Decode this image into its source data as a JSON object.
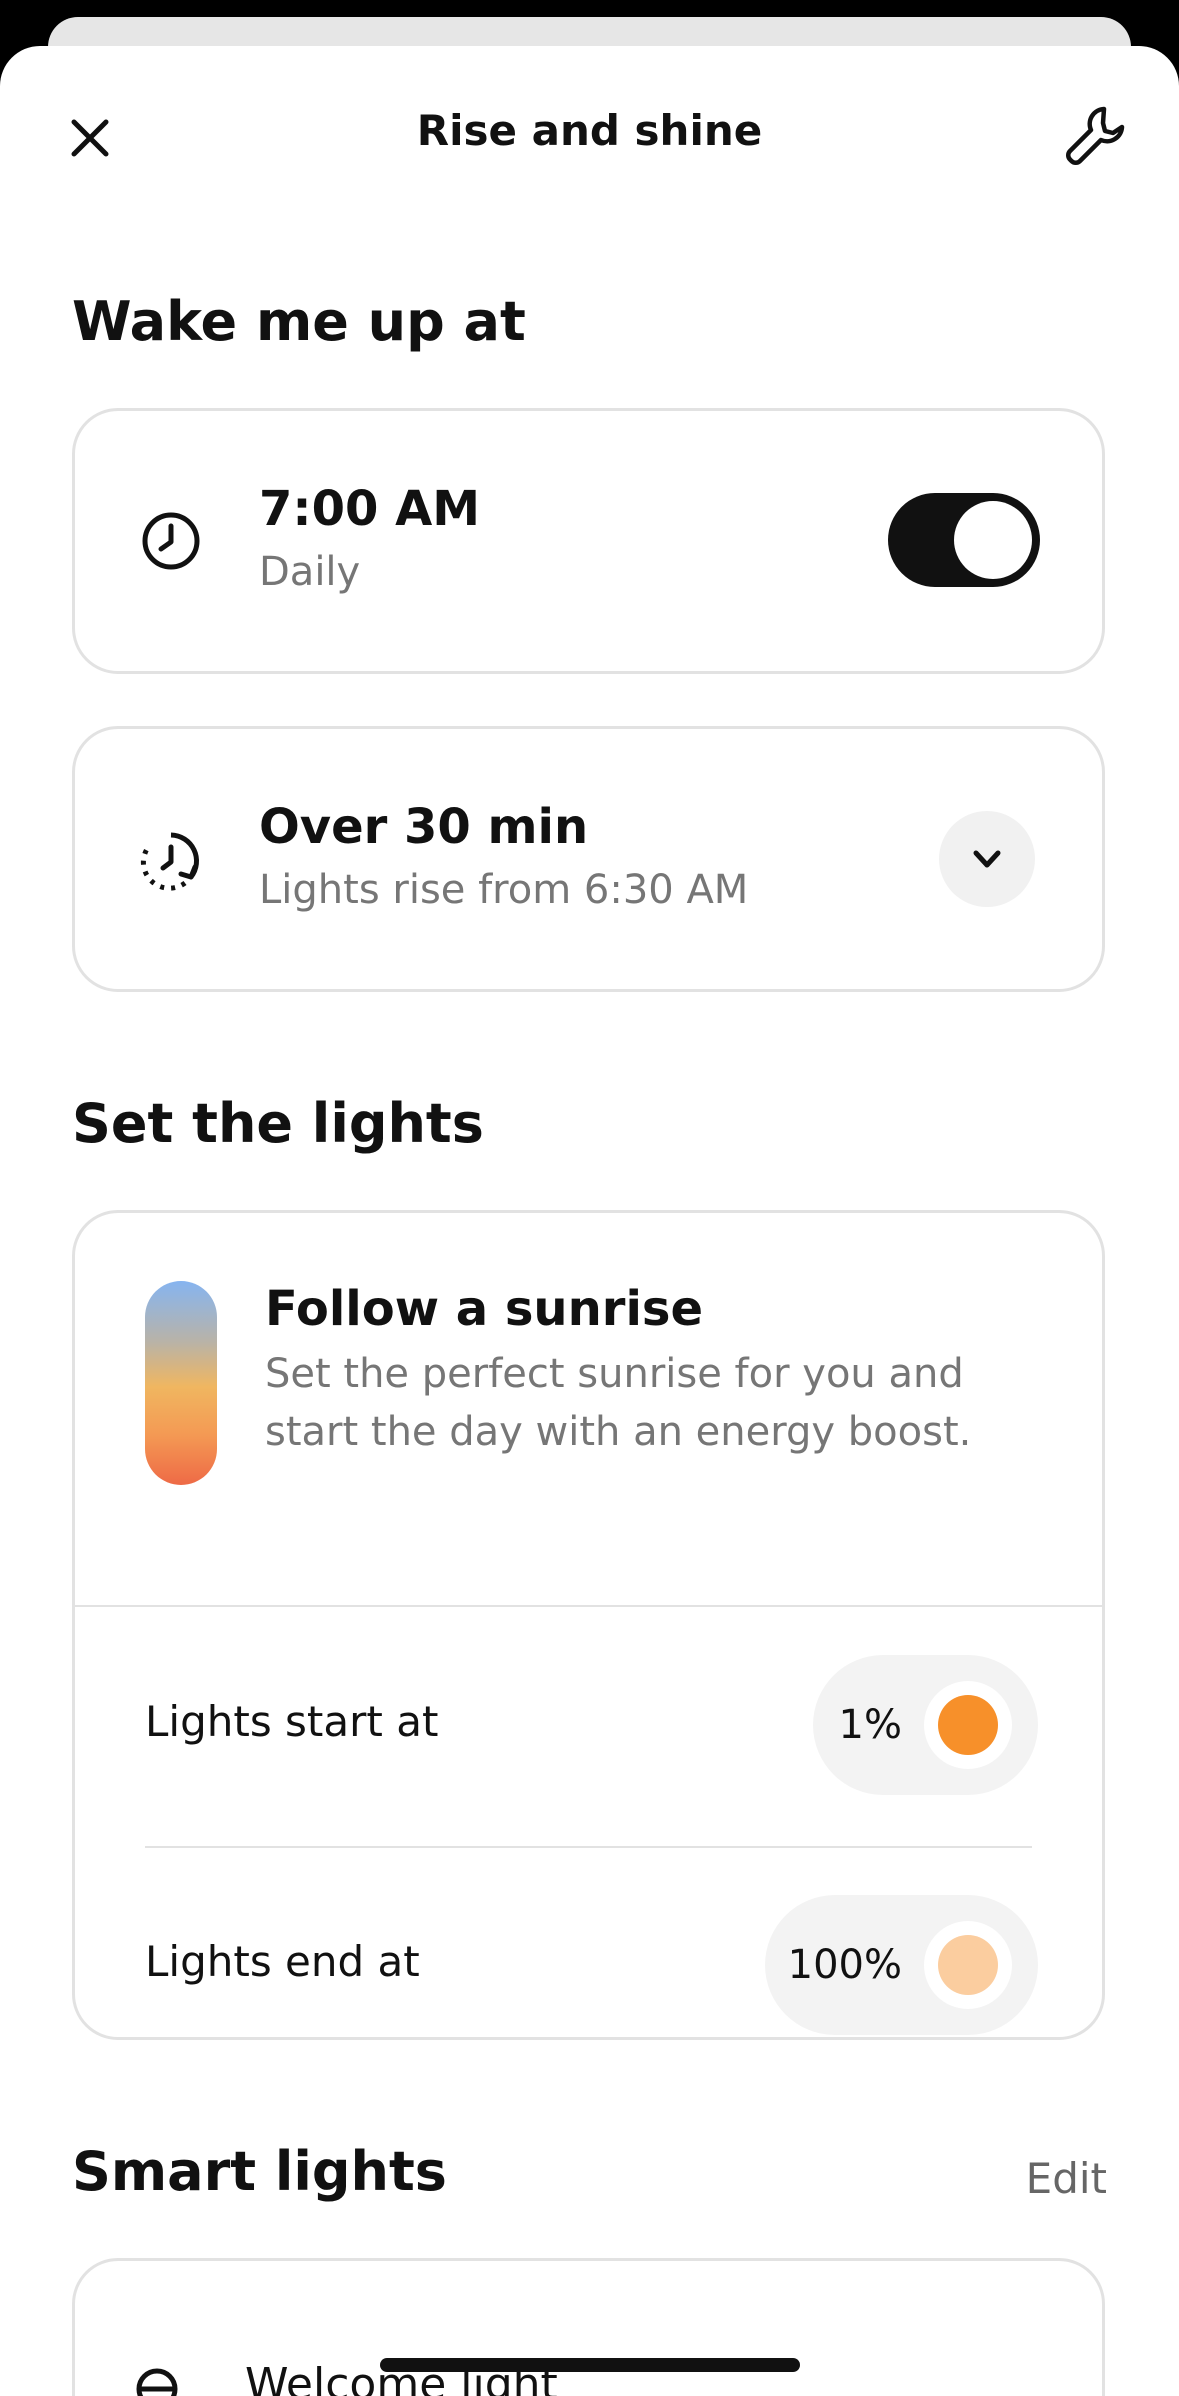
{
  "header": {
    "title": "Rise and shine"
  },
  "wake": {
    "section_title": "Wake me up at",
    "alarm": {
      "time": "7:00 AM",
      "repeat": "Daily",
      "enabled": true
    },
    "duration": {
      "title": "Over 30 min",
      "subtitle": "Lights rise from 6:30 AM"
    }
  },
  "lights": {
    "section_title": "Set the lights",
    "sunrise": {
      "title": "Follow a sunrise",
      "description_line1": "Set the perfect sunrise for you and",
      "description_line2": "start the day with an energy boost."
    },
    "start": {
      "label": "Lights start at",
      "value": "1%",
      "color": "#f7902a"
    },
    "end": {
      "label": "Lights end at",
      "value": "100%",
      "color": "#fbcd9f"
    }
  },
  "smart_lights": {
    "section_title": "Smart lights",
    "edit_label": "Edit",
    "items": [
      {
        "name": "Welcome light",
        "icon": "bulb-icon"
      }
    ]
  },
  "colors": {
    "toggle_on": "#111111",
    "accent_start": "#f7902a",
    "accent_end": "#fbcd9f"
  }
}
